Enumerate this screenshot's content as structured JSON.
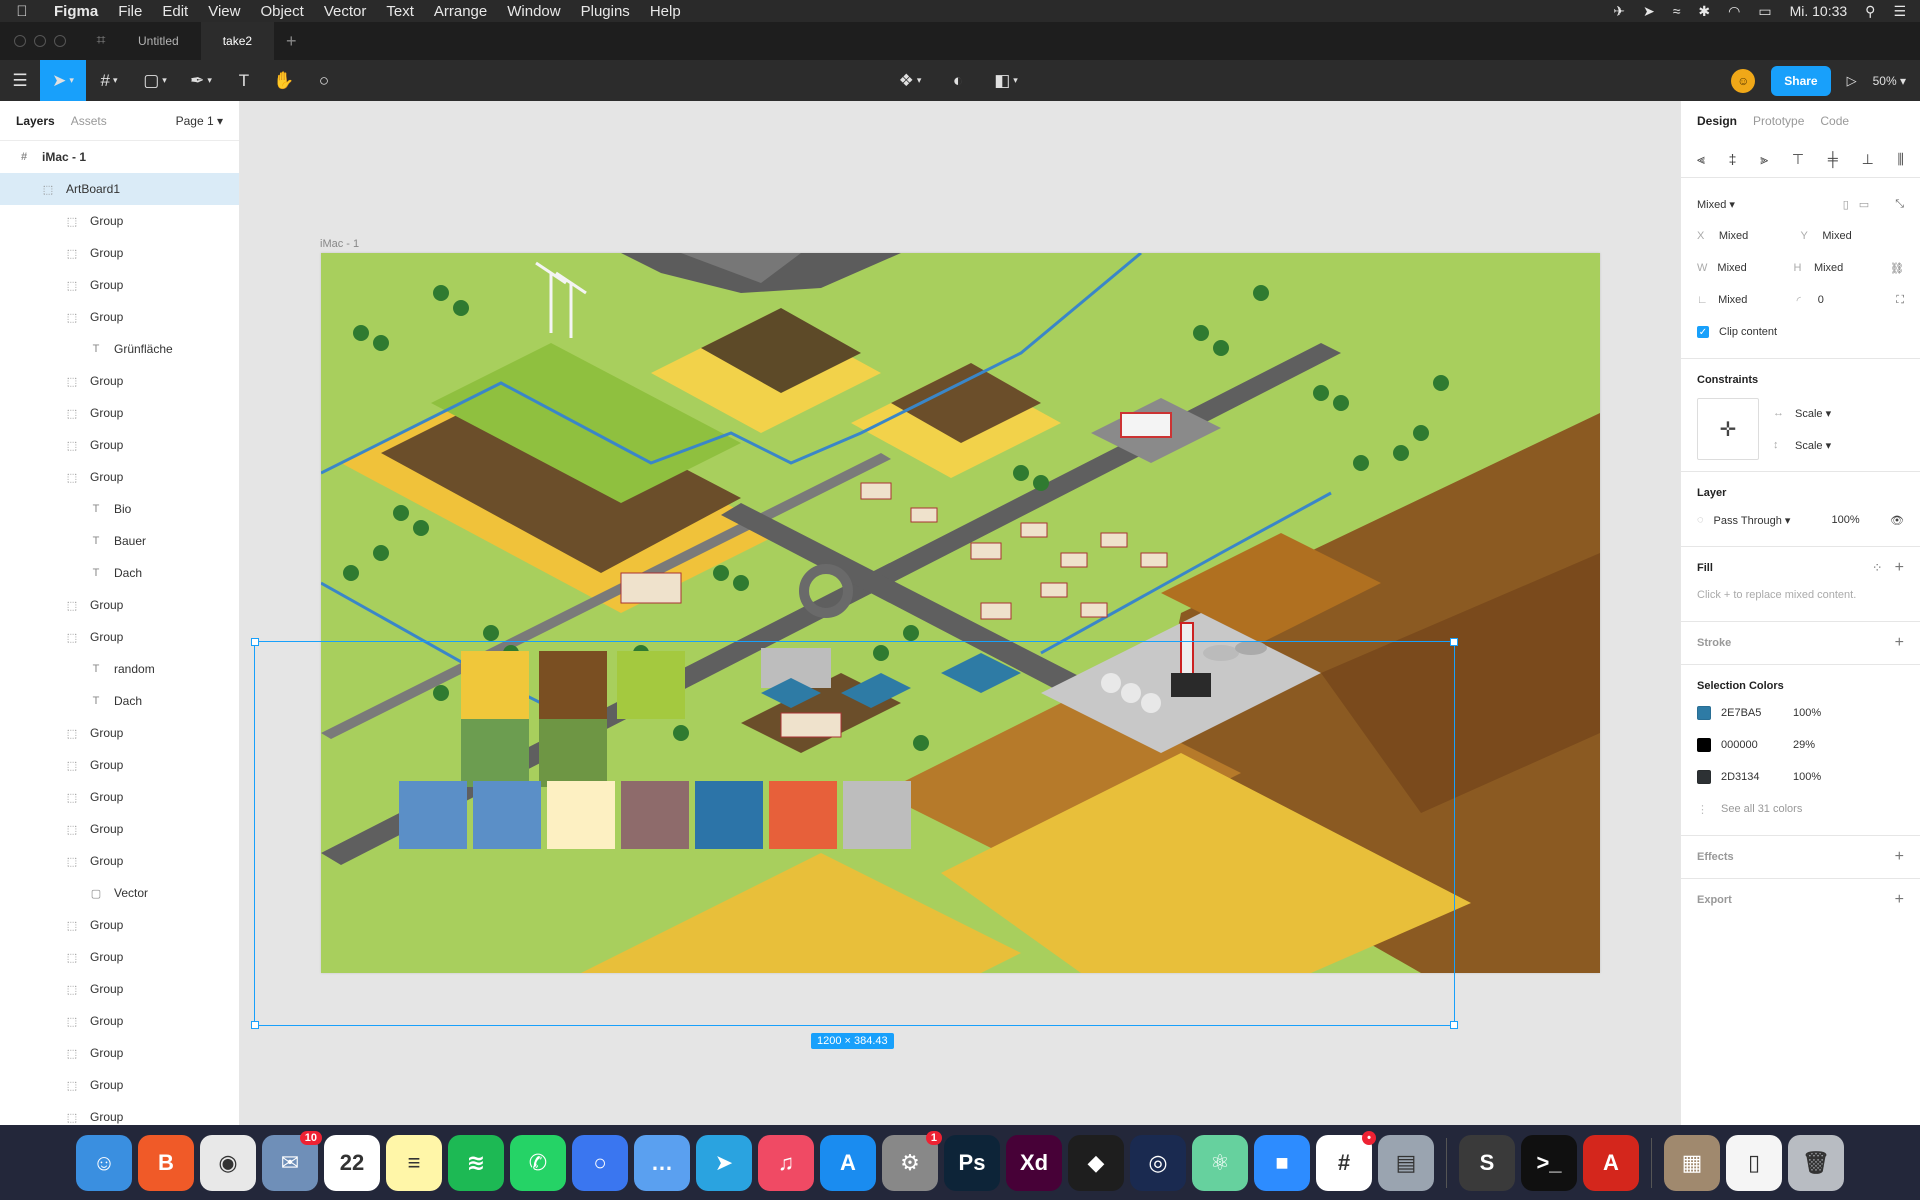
{
  "menubar": {
    "app_name": "Figma",
    "menus": [
      "File",
      "Edit",
      "View",
      "Object",
      "Vector",
      "Text",
      "Arrange",
      "Window",
      "Plugins",
      "Help"
    ],
    "clock": "Mi. 10:33"
  },
  "tabs": {
    "items": [
      "Untitled",
      "take2"
    ],
    "active": "take2"
  },
  "toolbar": {
    "share_label": "Share",
    "zoom": "50%"
  },
  "left_panel": {
    "tab_layers": "Layers",
    "tab_assets": "Assets",
    "page": "Page 1",
    "root_frame": "iMac - 1",
    "artboard": "ArtBoard1",
    "layers": [
      {
        "type": "group",
        "name": "Group"
      },
      {
        "type": "group",
        "name": "Group"
      },
      {
        "type": "group",
        "name": "Group"
      },
      {
        "type": "group",
        "name": "Group"
      },
      {
        "type": "text",
        "name": "Grünfläche"
      },
      {
        "type": "group",
        "name": "Group"
      },
      {
        "type": "group",
        "name": "Group"
      },
      {
        "type": "group",
        "name": "Group"
      },
      {
        "type": "group",
        "name": "Group"
      },
      {
        "type": "text",
        "name": "Bio"
      },
      {
        "type": "text",
        "name": "Bauer"
      },
      {
        "type": "text",
        "name": "Dach"
      },
      {
        "type": "group",
        "name": "Group"
      },
      {
        "type": "group",
        "name": "Group"
      },
      {
        "type": "text",
        "name": "random"
      },
      {
        "type": "text",
        "name": "Dach"
      },
      {
        "type": "group",
        "name": "Group"
      },
      {
        "type": "group",
        "name": "Group"
      },
      {
        "type": "group",
        "name": "Group"
      },
      {
        "type": "group",
        "name": "Group"
      },
      {
        "type": "group",
        "name": "Group"
      },
      {
        "type": "vector",
        "name": "Vector"
      },
      {
        "type": "group",
        "name": "Group"
      },
      {
        "type": "group",
        "name": "Group"
      },
      {
        "type": "group",
        "name": "Group"
      },
      {
        "type": "group",
        "name": "Group"
      },
      {
        "type": "group",
        "name": "Group"
      },
      {
        "type": "group",
        "name": "Group"
      },
      {
        "type": "group",
        "name": "Group"
      }
    ]
  },
  "canvas": {
    "frame_label": "iMac - 1",
    "selection_size": "1200 × 384.43",
    "help": "?",
    "swatches_row1": [
      "#f0c73a",
      "#7a4f22",
      "#a4c93f"
    ],
    "swatches_row2": [
      "#6c9d50",
      "#6e9644"
    ],
    "swatches_row3": [
      "#5b8fc7",
      "#5b8fc7",
      "#fdf0c2",
      "#8e6b6b",
      "#2c74a8",
      "#e7603a",
      "#bdbdbd"
    ]
  },
  "right_panel": {
    "tab_design": "Design",
    "tab_prototype": "Prototype",
    "tab_code": "Code",
    "mixed_label": "Mixed",
    "x_label": "X",
    "x_value": "Mixed",
    "y_label": "Y",
    "y_value": "Mixed",
    "w_label": "W",
    "w_value": "Mixed",
    "h_label": "H",
    "h_value": "Mixed",
    "rotation_value": "Mixed",
    "radius_value": "0",
    "clip_content": "Clip content",
    "constraints_title": "Constraints",
    "constraint_h": "Scale",
    "constraint_v": "Scale",
    "layer_title": "Layer",
    "blend_mode": "Pass Through",
    "opacity": "100%",
    "fill_title": "Fill",
    "fill_hint": "Click + to replace mixed content.",
    "stroke_title": "Stroke",
    "selection_colors_title": "Selection Colors",
    "selection_colors": [
      {
        "hex": "2E7BA5",
        "opacity": "100%",
        "swatch": "#2E7BA5"
      },
      {
        "hex": "000000",
        "opacity": "29%",
        "swatch": "#000000"
      },
      {
        "hex": "2D3134",
        "opacity": "100%",
        "swatch": "#2D3134"
      }
    ],
    "see_all_colors": "See all 31 colors",
    "effects_title": "Effects",
    "export_title": "Export"
  },
  "dock": {
    "apps": [
      {
        "name": "finder",
        "color": "#3a8fe0",
        "glyph": "☺"
      },
      {
        "name": "brave",
        "color": "#f05a28",
        "glyph": "B"
      },
      {
        "name": "chrome",
        "color": "#e8e8e8",
        "glyph": "◉"
      },
      {
        "name": "mail",
        "color": "#6f8fb8",
        "glyph": "✉",
        "badge": "10"
      },
      {
        "name": "calendar",
        "color": "#ffffff",
        "glyph": "22"
      },
      {
        "name": "notes",
        "color": "#fff6a8",
        "glyph": "≡"
      },
      {
        "name": "spotify",
        "color": "#1db954",
        "glyph": "≋"
      },
      {
        "name": "whatsapp",
        "color": "#25d366",
        "glyph": "✆"
      },
      {
        "name": "signal",
        "color": "#3a76f0",
        "glyph": "○"
      },
      {
        "name": "messages",
        "color": "#5aa0f0",
        "glyph": "…"
      },
      {
        "name": "telegram",
        "color": "#2aa3e0",
        "glyph": "➤"
      },
      {
        "name": "music",
        "color": "#f04a64",
        "glyph": "♫"
      },
      {
        "name": "app-store",
        "color": "#1a8cf0",
        "glyph": "A"
      },
      {
        "name": "system-preferences",
        "color": "#888888",
        "glyph": "⚙",
        "badge": "1"
      },
      {
        "name": "photoshop",
        "color": "#0d2438",
        "glyph": "Ps"
      },
      {
        "name": "adobe-xd",
        "color": "#470137",
        "glyph": "Xd"
      },
      {
        "name": "figma",
        "color": "#1e1e1e",
        "glyph": "◆"
      },
      {
        "name": "cinema-4d",
        "color": "#1a2a50",
        "glyph": "◎"
      },
      {
        "name": "atom",
        "color": "#66d19e",
        "glyph": "⚛"
      },
      {
        "name": "zoom",
        "color": "#2d8cff",
        "glyph": "■"
      },
      {
        "name": "slack",
        "color": "#ffffff",
        "glyph": "#",
        "badge": "•"
      },
      {
        "name": "preview",
        "color": "#9aa4b0",
        "glyph": "▤"
      },
      {
        "name": "sublime-text",
        "color": "#3a3a3a",
        "glyph": "S"
      },
      {
        "name": "terminal",
        "color": "#101010",
        "glyph": ">_"
      },
      {
        "name": "acrobat",
        "color": "#d4261c",
        "glyph": "A"
      },
      {
        "name": "downloads-stack",
        "color": "#a0896e",
        "glyph": "▦"
      },
      {
        "name": "document",
        "color": "#f5f5f5",
        "glyph": "▯"
      },
      {
        "name": "trash",
        "color": "#b8bcc2",
        "glyph": "🗑"
      }
    ]
  }
}
